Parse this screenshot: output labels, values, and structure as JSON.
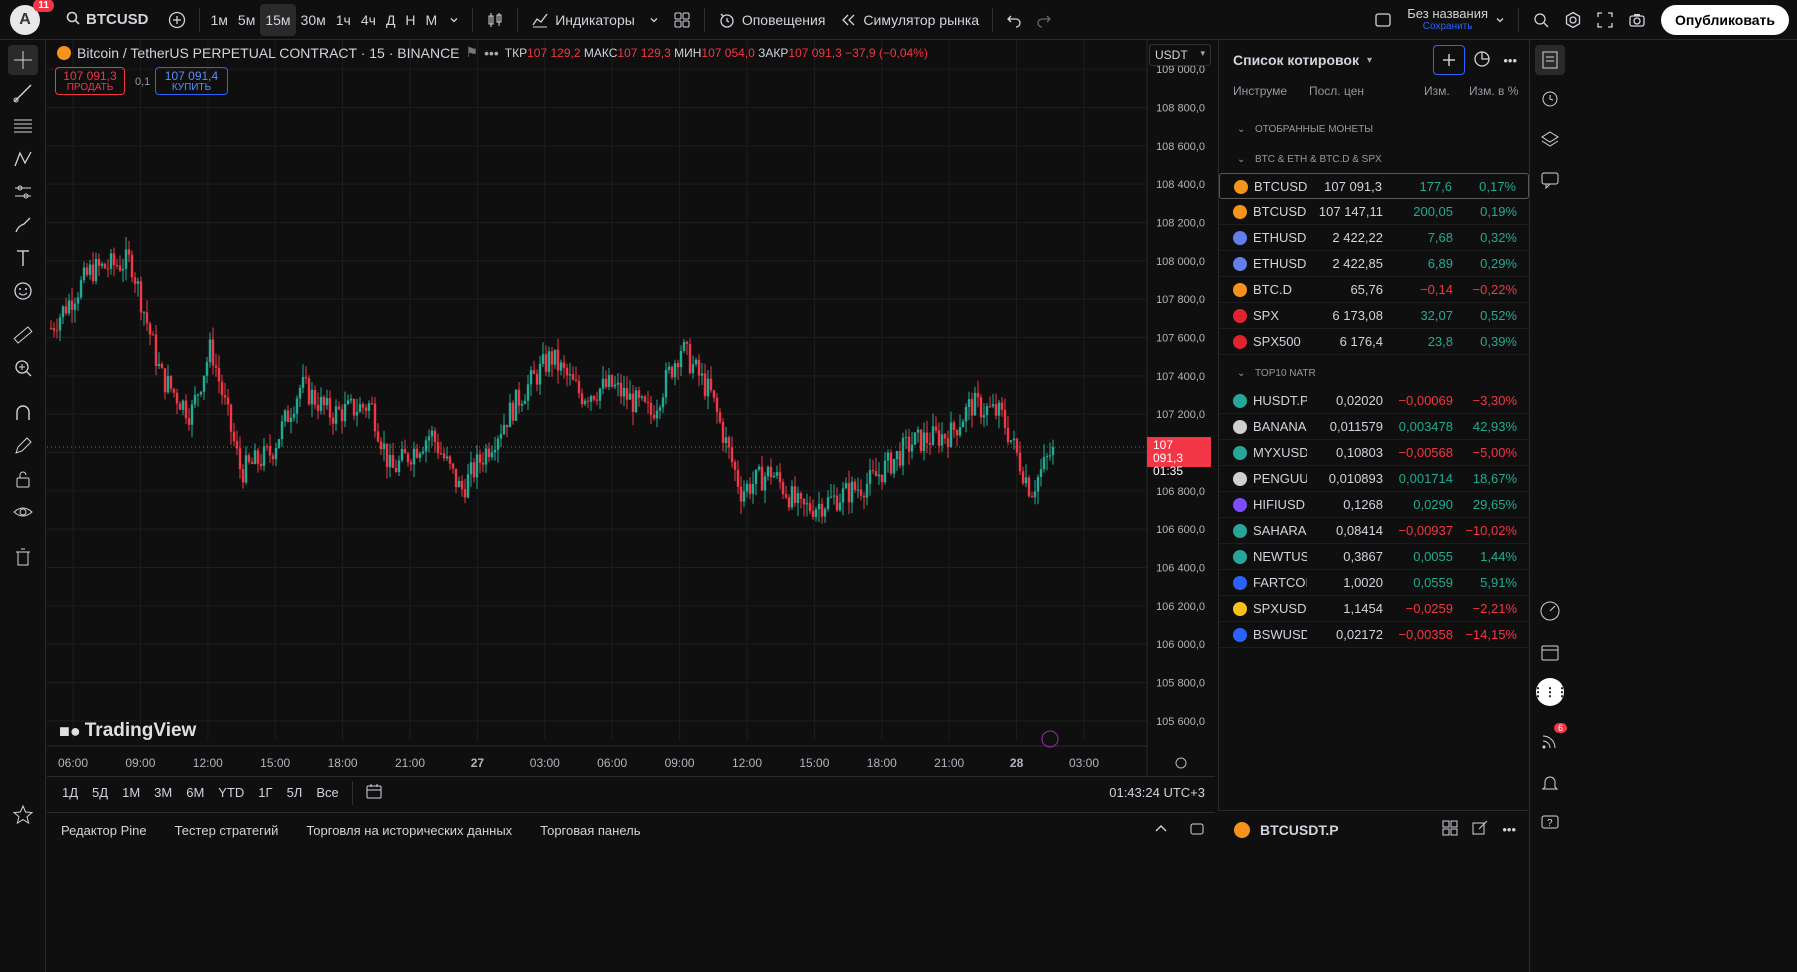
{
  "topbar": {
    "avatar_letter": "A",
    "notifications": "11",
    "symbol": "BTCUSD",
    "intervals": [
      "1м",
      "5м",
      "15м",
      "30м",
      "1ч",
      "4ч",
      "Д",
      "Н",
      "М"
    ],
    "active_interval": "15м",
    "indicators": "Индикаторы",
    "alerts": "Оповещения",
    "replay": "Симулятор рынка",
    "layout_name": "Без названия",
    "save": "Сохранить",
    "publish": "Опубликовать"
  },
  "chart": {
    "legend_title": "Bitcoin / TetherUS PERPETUAL CONTRACT · 15 · BINANCE",
    "o_label": "ТКР",
    "o_value": "107 129,2",
    "h_label": "МАКС",
    "h_value": "107 129,3",
    "l_label": "МИН",
    "l_value": "107 054,0",
    "c_label": "ЗАКР",
    "c_value": "107 091,3",
    "change": "−37,9 (−0,04%)",
    "sell_price": "107 091,3",
    "sell_label": "ПРОДАТЬ",
    "buy_price": "107 091,4",
    "buy_label": "КУПИТЬ",
    "spread": "0,1",
    "currency": "USDT",
    "last_price": "107 091,3",
    "countdown": "01:35",
    "logo": "TradingView",
    "yticks": [
      "109 000,0",
      "108 800,0",
      "108 600,0",
      "108 400,0",
      "108 200,0",
      "108 000,0",
      "107 800,0",
      "107 600,0",
      "107 400,0",
      "107 200,0",
      "107 000,0",
      "106 800,0",
      "106 600,0",
      "106 400,0",
      "106 200,0",
      "106 000,0",
      "105 800,0",
      "105 600,0"
    ],
    "xticks": [
      "06:00",
      "09:00",
      "12:00",
      "15:00",
      "18:00",
      "21:00",
      "27",
      "03:00",
      "06:00",
      "09:00",
      "12:00",
      "15:00",
      "18:00",
      "21:00",
      "28",
      "03:00"
    ]
  },
  "rangebar": {
    "ranges": [
      "1Д",
      "5Д",
      "1М",
      "3М",
      "6М",
      "YTD",
      "1Г",
      "5Л",
      "Все"
    ],
    "clock": "01:43:24 UTC+3"
  },
  "bottompanel": {
    "tabs": [
      "Редактор Pine",
      "Тестер стратегий",
      "Торговля на исторических данных",
      "Торговая панель"
    ]
  },
  "watchlist": {
    "title": "Список котировок",
    "col_symbol": "Инструме",
    "col_last": "Посл. цен",
    "col_chg": "Изм.",
    "col_chgp": "Изм. в %",
    "section1": "ОТОБРАННЫЕ МОНЕТЫ",
    "section2": "BTC & ETH & BTC.D & SPX",
    "section3": "TOP10 NATR",
    "group2": [
      {
        "sym": "BTCUSD",
        "last": "107 091,3",
        "chg": "177,6",
        "chgp": "0,17%",
        "dir": "pos",
        "color": "#f7931a"
      },
      {
        "sym": "BTCUSD",
        "last": "107 147,11",
        "chg": "200,05",
        "chgp": "0,19%",
        "dir": "pos",
        "color": "#f7931a"
      },
      {
        "sym": "ETHUSD",
        "last": "2 422,22",
        "chg": "7,68",
        "chgp": "0,32%",
        "dir": "pos",
        "color": "#627eea"
      },
      {
        "sym": "ETHUSD",
        "last": "2 422,85",
        "chg": "6,89",
        "chgp": "0,29%",
        "dir": "pos",
        "color": "#627eea"
      },
      {
        "sym": "BTC.D",
        "last": "65,76",
        "chg": "−0,14",
        "chgp": "−0,22%",
        "dir": "neg",
        "color": "#f7931a"
      },
      {
        "sym": "SPX",
        "last": "6 173,08",
        "chg": "32,07",
        "chgp": "0,52%",
        "dir": "pos",
        "color": "#e0242f"
      },
      {
        "sym": "SPX500",
        "last": "6 176,4",
        "chg": "23,8",
        "chgp": "0,39%",
        "dir": "pos",
        "color": "#e0242f"
      }
    ],
    "group3": [
      {
        "sym": "HUSDT.P",
        "last": "0,02020",
        "chg": "−0,00069",
        "chgp": "−3,30%",
        "dir": "neg",
        "color": "#26a69a"
      },
      {
        "sym": "BANANAS",
        "last": "0,011579",
        "chg": "0,003478",
        "chgp": "42,93%",
        "dir": "pos",
        "color": "#cfcfcf"
      },
      {
        "sym": "MYXUSD",
        "last": "0,10803",
        "chg": "−0,00568",
        "chgp": "−5,00%",
        "dir": "neg",
        "color": "#26a69a"
      },
      {
        "sym": "PENGUU",
        "last": "0,010893",
        "chg": "0,001714",
        "chgp": "18,67%",
        "dir": "pos",
        "color": "#cfcfcf"
      },
      {
        "sym": "HIFIUSD",
        "last": "0,1268",
        "chg": "0,0290",
        "chgp": "29,65%",
        "dir": "pos",
        "color": "#7b4dff"
      },
      {
        "sym": "SAHARA",
        "last": "0,08414",
        "chg": "−0,00937",
        "chgp": "−10,02%",
        "dir": "neg",
        "color": "#26a69a"
      },
      {
        "sym": "NEWTUS",
        "last": "0,3867",
        "chg": "0,0055",
        "chgp": "1,44%",
        "dir": "pos",
        "color": "#26a69a"
      },
      {
        "sym": "FARTCOI",
        "last": "1,0020",
        "chg": "0,0559",
        "chgp": "5,91%",
        "dir": "pos",
        "color": "#2962ff"
      },
      {
        "sym": "SPXUSD",
        "last": "1,1454",
        "chg": "−0,0259",
        "chgp": "−2,21%",
        "dir": "neg",
        "color": "#f7c21a"
      },
      {
        "sym": "BSWUSD",
        "last": "0,02172",
        "chg": "−0,00358",
        "chgp": "−14,15%",
        "dir": "neg",
        "color": "#2962ff"
      }
    ],
    "footer_symbol": "BTCUSDT.P"
  },
  "righttools": {
    "notification_badge": "6"
  }
}
